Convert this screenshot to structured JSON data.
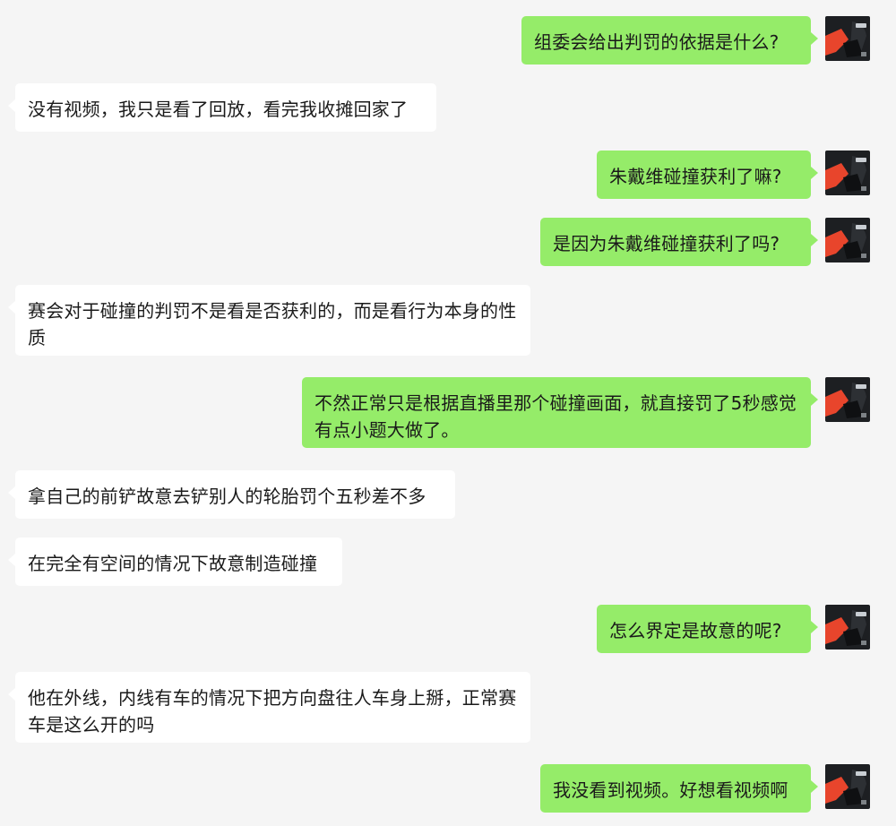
{
  "colors": {
    "background": "#f5f5f5",
    "sent_bubble": "#95ec69",
    "received_bubble": "#ffffff",
    "text": "#1a1a1a",
    "avatar_accent": "#e8452c"
  },
  "conversation": {
    "messages": [
      {
        "sender": "me",
        "text": "组委会给出判罚的依据是什么?"
      },
      {
        "sender": "other",
        "text": "没有视频，我只是看了回放，看完我收摊回家了"
      },
      {
        "sender": "me",
        "text": "朱戴维碰撞获利了嘛?"
      },
      {
        "sender": "me",
        "text": "是因为朱戴维碰撞获利了吗?"
      },
      {
        "sender": "other",
        "text": "赛会对于碰撞的判罚不是看是否获利的，而是看行为本身的性质"
      },
      {
        "sender": "me",
        "text": "不然正常只是根据直播里那个碰撞画面，就直接罚了5秒感觉有点小题大做了。"
      },
      {
        "sender": "other",
        "text": "拿自己的前铲故意去铲别人的轮胎罚个五秒差不多"
      },
      {
        "sender": "other",
        "text": "在完全有空间的情况下故意制造碰撞"
      },
      {
        "sender": "me",
        "text": "怎么界定是故意的呢?"
      },
      {
        "sender": "other",
        "text": "他在外线，内线有车的情况下把方向盘往人车身上掰，正常赛车是这么开的吗"
      },
      {
        "sender": "me",
        "text": "我没看到视频。好想看视频啊"
      }
    ],
    "avatar_icon": "race-car-helmet-icon"
  }
}
